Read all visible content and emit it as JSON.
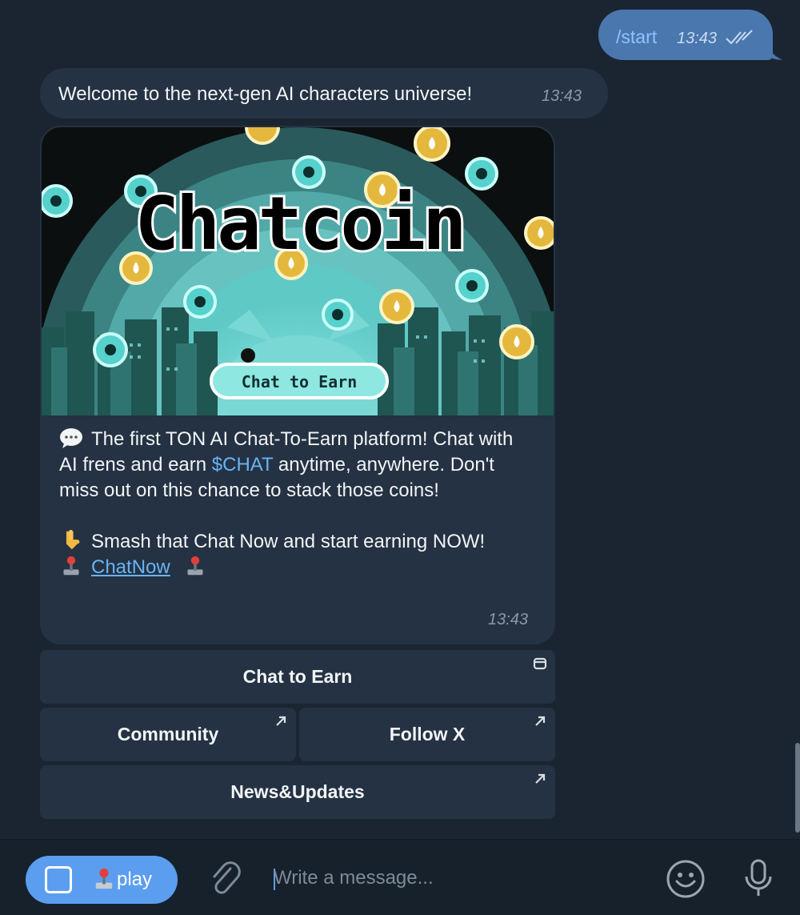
{
  "outgoing": {
    "text": "/start",
    "time": "13:43"
  },
  "welcome": {
    "text": "Welcome to the next-gen AI characters universe!",
    "time": "13:43"
  },
  "banner": {
    "title": "Chatcoin",
    "button": "Chat to Earn"
  },
  "card": {
    "line1_pre": "The first TON AI Chat-To-Earn platform! Chat with AI frens and earn ",
    "line1_cash": "$CHAT",
    "line1_post": " anytime, anywhere. Don't miss out on this chance to stack those coins!",
    "line2": "Smash that Chat Now and start earning NOW!",
    "link": "ChatNow",
    "time": "13:43"
  },
  "buttons": {
    "chat_to_earn": "Chat to Earn",
    "community": "Community",
    "follow_x": "Follow X",
    "news": "News&Updates"
  },
  "composer": {
    "play_label": "play",
    "placeholder": "Write a message..."
  },
  "colors": {
    "accent": "#5b9ef0",
    "link": "#6ab3f3",
    "outgoing_bubble": "#4a77ae",
    "incoming_bubble": "#243243",
    "background": "#1b2532"
  }
}
